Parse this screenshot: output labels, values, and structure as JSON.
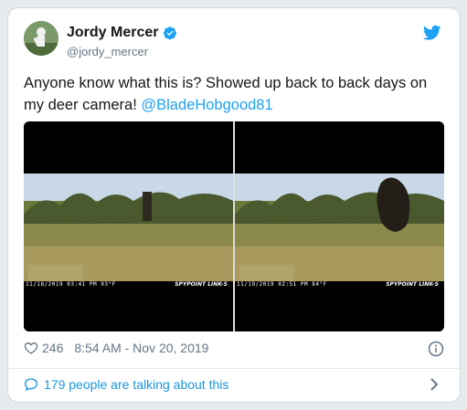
{
  "author": {
    "display_name": "Jordy Mercer",
    "handle": "@jordy_mercer",
    "verified": true
  },
  "tweet": {
    "text_before": "Anyone know what this is? Showed up back to back days on my deer camera! ",
    "mention": "@BladeHobgood81"
  },
  "media": {
    "left_frame": {
      "timestamp": "11/18/2019  03:41 PM    93°F",
      "brand": "SPYPOINT LINK-S"
    },
    "right_frame": {
      "timestamp": "11/19/2019  02:51 PM    84°F",
      "brand": "SPYPOINT LINK-S"
    }
  },
  "meta": {
    "likes": "246",
    "timestamp": "8:54 AM - Nov 20, 2019"
  },
  "conversation": {
    "label": "179 people are talking about this"
  },
  "colors": {
    "accent": "#1da1f2",
    "link": "#1b95e0",
    "muted": "#657786"
  },
  "icons": {
    "verified": "verified-badge-icon",
    "logo": "twitter-bird-icon",
    "like": "heart-icon",
    "info": "info-icon",
    "reply": "speech-bubble-icon",
    "chevron": "chevron-right-icon"
  }
}
